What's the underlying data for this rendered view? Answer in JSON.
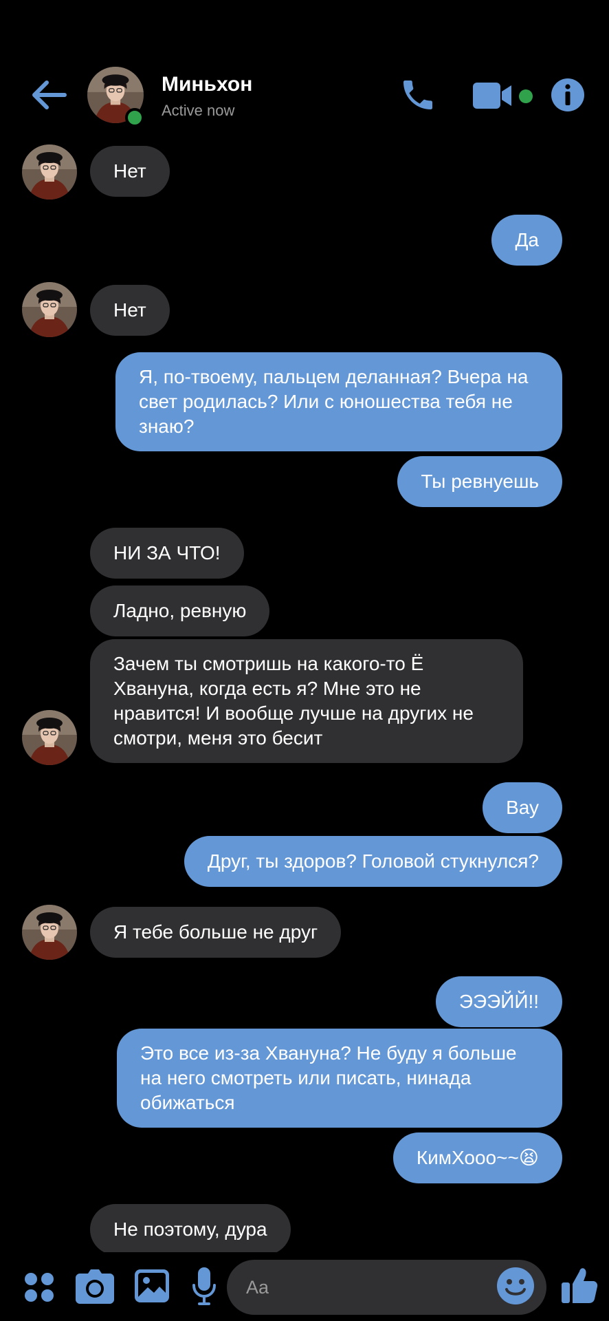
{
  "header": {
    "name": "Миньхон",
    "status": "Active now"
  },
  "colors": {
    "accent": "#6497d6",
    "incoming_bubble": "#303033",
    "online": "#31a24c",
    "background": "#000000"
  },
  "messages": [
    {
      "from": "them",
      "text": "Нет"
    },
    {
      "from": "me",
      "text": "Да"
    },
    {
      "from": "them",
      "text": "Нет"
    },
    {
      "from": "me",
      "text": "Я, по-твоему, пальцем деланная? Вчера на свет родилась? Или с юношества тебя не знаю?"
    },
    {
      "from": "me",
      "text": "Ты ревнуешь"
    },
    {
      "from": "them",
      "text": "НИ ЗА ЧТО!"
    },
    {
      "from": "them",
      "text": "Ладно, ревную"
    },
    {
      "from": "them",
      "text": "Зачем ты смотришь на какого-то Ё Хвануна, когда есть я? Мне это не нравится! И вообще лучше на других не смотри, меня это бесит"
    },
    {
      "from": "me",
      "text": "Вау"
    },
    {
      "from": "me",
      "text": "Друг, ты здоров? Головой стукнулся?"
    },
    {
      "from": "them",
      "text": "Я тебе больше не друг"
    },
    {
      "from": "me",
      "text": "ЭЭЭЙЙ!!"
    },
    {
      "from": "me",
      "text": "Это все из-за Хвануна? Не буду я больше на него смотреть или писать, нинада обижаться"
    },
    {
      "from": "me",
      "text": "КимХооо~~😫"
    },
    {
      "from": "them",
      "text": "Не поэтому, дура"
    }
  ],
  "composer": {
    "placeholder": "Aa"
  },
  "icons": {
    "back": "arrow-left-icon",
    "call": "phone-icon",
    "video": "video-camera-icon",
    "info": "info-icon",
    "apps": "four-dots-icon",
    "camera": "camera-icon",
    "gallery": "image-icon",
    "mic": "microphone-icon",
    "emoji": "smiley-icon",
    "like": "thumbs-up-icon"
  }
}
